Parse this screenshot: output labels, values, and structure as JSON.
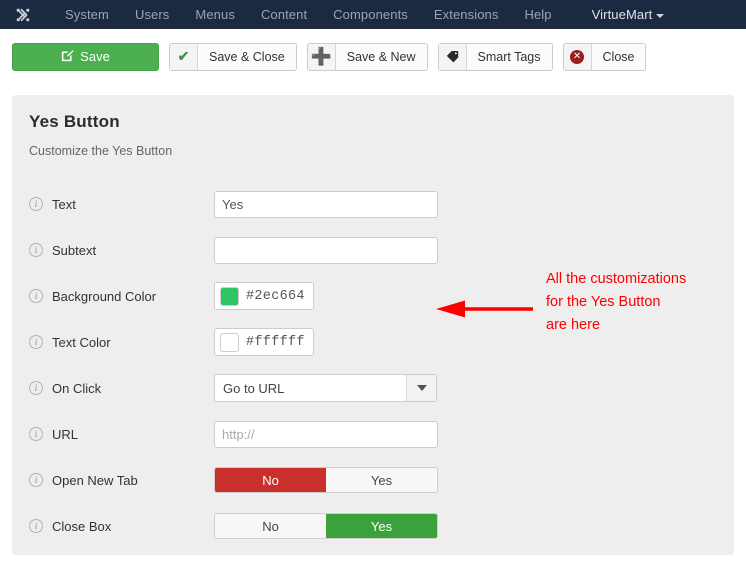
{
  "nav": {
    "logo_icon": "joomla-logo-icon",
    "items": [
      {
        "label": "System"
      },
      {
        "label": "Users"
      },
      {
        "label": "Menus"
      },
      {
        "label": "Content"
      },
      {
        "label": "Components"
      },
      {
        "label": "Extensions"
      },
      {
        "label": "Help"
      }
    ],
    "brand": {
      "label": "VirtueMart",
      "caret_icon": "caret-down-icon"
    }
  },
  "toolbar": {
    "buttons": [
      {
        "label": "Save",
        "icon": "edit-pencil-square-icon",
        "style": "primary"
      },
      {
        "label": "Save & Close",
        "icon": "checkmark-icon",
        "style": "default"
      },
      {
        "label": "Save & New",
        "icon": "plus-icon",
        "style": "default"
      },
      {
        "label": "Smart Tags",
        "icon": "tag-icon",
        "style": "default"
      },
      {
        "label": "Close",
        "icon": "close-circle-icon",
        "style": "default"
      }
    ]
  },
  "panel": {
    "title": "Yes Button",
    "subtitle": "Customize the Yes Button"
  },
  "form": {
    "info_icon": "info-circle-icon",
    "fields": {
      "text": {
        "label": "Text",
        "value": "Yes",
        "placeholder": ""
      },
      "subtext": {
        "label": "Subtext",
        "value": "",
        "placeholder": ""
      },
      "background_color": {
        "label": "Background Color",
        "value": "#2ec664",
        "swatch": "#2ec664"
      },
      "text_color": {
        "label": "Text Color",
        "value": "#ffffff",
        "swatch": "#ffffff"
      },
      "on_click": {
        "label": "On Click",
        "value": "Go to URL",
        "caret_icon": "dropdown-triangle-icon"
      },
      "url": {
        "label": "URL",
        "value": "",
        "placeholder": "http://"
      },
      "open_new_tab": {
        "label": "Open New Tab",
        "option_no": "No",
        "option_yes": "Yes",
        "selected": "No",
        "selected_color": "#c9302c"
      },
      "close_box": {
        "label": "Close Box",
        "option_no": "No",
        "option_yes": "Yes",
        "selected": "Yes",
        "selected_color": "#3ba13b"
      }
    }
  },
  "annotation": {
    "text": "All the customizations for the Yes Button are here",
    "line1": "All the customizations",
    "line2": "for the Yes Button",
    "line3": "are here",
    "color": "#ff0000",
    "arrow_icon": "left-arrow-annotation-icon"
  },
  "colors": {
    "nav_background": "#1c2a41",
    "panel_background": "#eeeeee",
    "primary_green": "#4caf50",
    "danger_red": "#c9302c",
    "annotation_red": "#ff0000"
  }
}
